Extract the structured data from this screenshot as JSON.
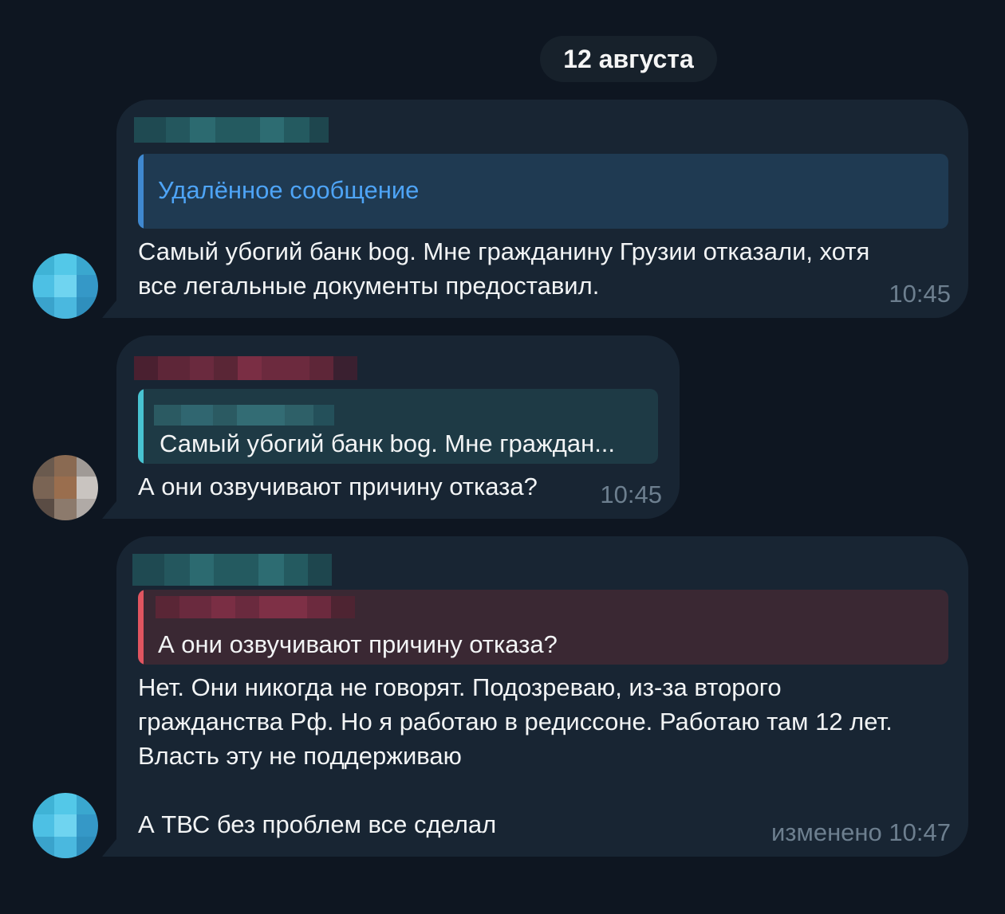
{
  "date_divider": "12 августа",
  "messages": [
    {
      "reply_title": "Удалённое сообщение",
      "text": "Самый убогий банк bog. Мне гражданину Грузии отказали, хотя\nвсе легальные документы предоставил.",
      "time": "10:45"
    },
    {
      "reply_text": "Самый убогий банк bog. Мне граждан...",
      "text": "А они озвучивают причину отказа?",
      "time": "10:45"
    },
    {
      "reply_text": "А они озвучивают причину отказа?",
      "text": "Нет. Они никогда не говорят. Подозреваю, из-за второго\nгражданства Рф. Но я работаю в редиссоне. Работаю там 12 лет.\nВласть эту не поддерживаю\n\nА ТВС без проблем все сделал",
      "edited_label": "изменено",
      "time": "10:47"
    }
  ],
  "colors": {
    "background": "#0e1621",
    "bubble": "#182533",
    "link_blue": "#4ea4f6",
    "reply_bar_blue": "#3f88cf",
    "reply_bar_cyan": "#48c3d1",
    "reply_bar_red": "#e05560",
    "timestamp": "#6d7f8f"
  }
}
